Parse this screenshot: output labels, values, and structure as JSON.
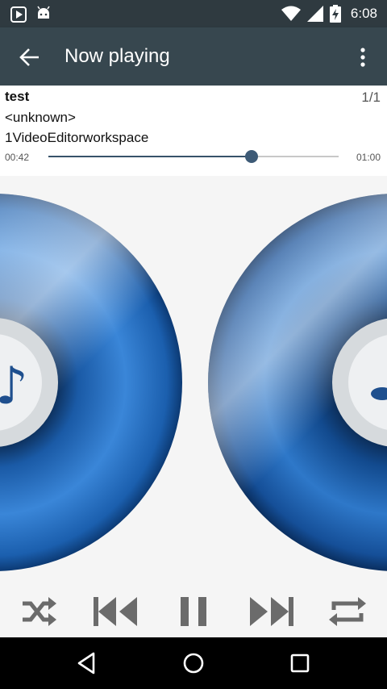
{
  "status_bar": {
    "time": "6:08",
    "left_icons": [
      "media-play-icon",
      "android-icon"
    ],
    "right_icons": [
      "wifi-icon",
      "cell-signal-icon",
      "battery-charging-icon"
    ]
  },
  "app_bar": {
    "title": "Now playing",
    "back_icon": "arrow-back-icon",
    "menu_icon": "more-vert-icon",
    "background": "#37474f"
  },
  "track": {
    "title": "test",
    "counter": "1/1",
    "artist": "<unknown>",
    "album": "1VideoEditorworkspace",
    "elapsed": "00:42",
    "duration": "01:00",
    "progress": 0.7
  },
  "album_art": {
    "description_icon": "music-disc-icon",
    "accent": "#1f5fa8"
  },
  "controls": {
    "shuffle_icon": "shuffle-icon",
    "previous_icon": "skip-previous-icon",
    "pause_icon": "pause-icon",
    "next_icon": "skip-next-icon",
    "repeat_icon": "repeat-icon",
    "icon_color": "#6b6b6b"
  },
  "nav_bar": {
    "back_icon": "nav-back-icon",
    "home_icon": "nav-home-icon",
    "recents_icon": "nav-recents-icon"
  }
}
